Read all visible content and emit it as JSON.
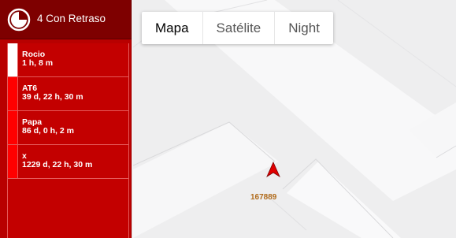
{
  "delay_panel": {
    "title": "4 Con Retraso",
    "header_icon": "clock-icon",
    "items": [
      {
        "name": "Rocio",
        "time": "1 h, 8 m",
        "status_color": "#ffffff"
      },
      {
        "name": "AT6",
        "time": "39 d, 22 h, 30 m",
        "status_color": "#ff0000"
      },
      {
        "name": "Papa",
        "time": "86 d, 0 h, 2 m",
        "status_color": "#ff0000"
      },
      {
        "name": "x",
        "time": "1229 d, 22 h, 30 m",
        "status_color": "#ff0000"
      }
    ]
  },
  "map": {
    "type_tabs": [
      {
        "label": "Mapa",
        "active": true
      },
      {
        "label": "Satélite",
        "active": false
      },
      {
        "label": "Night",
        "active": false
      }
    ],
    "marker": {
      "icon": "navigation-arrow-icon",
      "label": "167889",
      "color": "#e00000"
    }
  },
  "colors": {
    "panel_bg": "#b80000",
    "header_bg": "#7e0000",
    "map_bg": "#eeeeef"
  }
}
